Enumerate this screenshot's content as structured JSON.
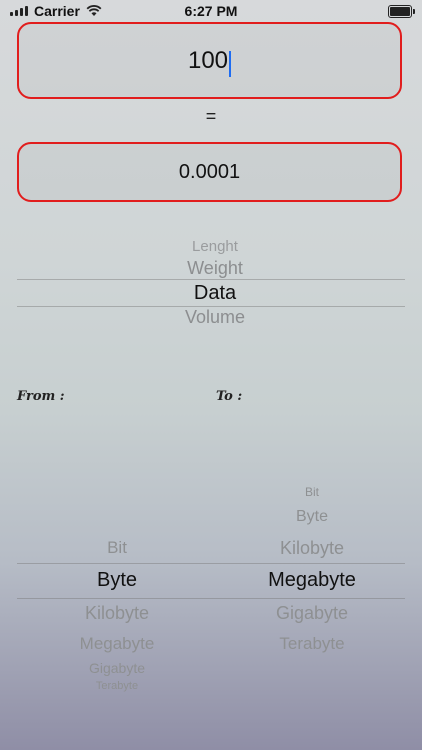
{
  "status_bar": {
    "carrier": "Carrier",
    "time": "6:27 PM"
  },
  "input": {
    "value": "100"
  },
  "equals_sign": "=",
  "output": {
    "value": "0.0001"
  },
  "category_picker": {
    "items": [
      "Lenght",
      "Weight",
      "Data",
      "Volume"
    ],
    "selected": "Data"
  },
  "labels": {
    "from": "From :",
    "to": "To :"
  },
  "from_picker": {
    "items": [
      "Bit",
      "Byte",
      "Kilobyte",
      "Megabyte",
      "Gigabyte",
      "Terabyte"
    ],
    "selected": "Byte"
  },
  "to_picker": {
    "items": [
      "Bit",
      "Byte",
      "Kilobyte",
      "Megabyte",
      "Gigabyte",
      "Terabyte"
    ],
    "selected": "Megabyte"
  },
  "colors": {
    "field_border": "#e11d1d",
    "caret": "#1e6cf2"
  }
}
